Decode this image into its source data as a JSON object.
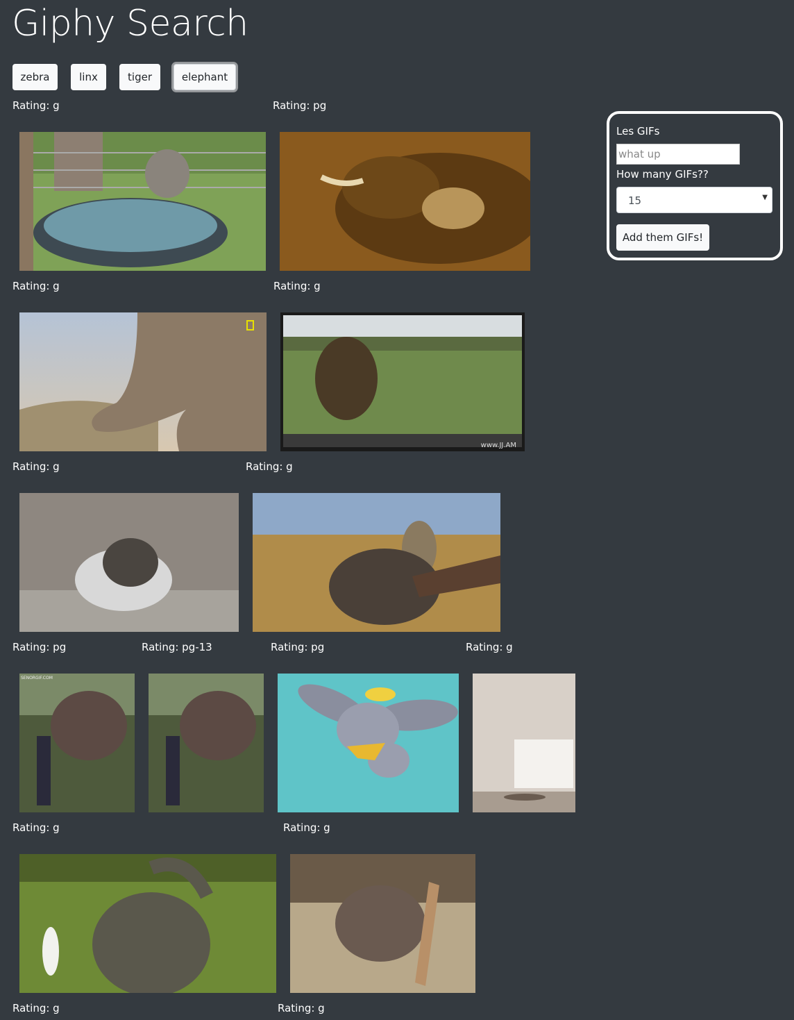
{
  "title": "Giphy Search",
  "topics": [
    "zebra",
    "linx",
    "tiger",
    "elephant"
  ],
  "active_topic": "elephant",
  "ratings": {
    "r1": [
      "Rating: g",
      "Rating: pg"
    ],
    "r2": [
      "Rating: g",
      "Rating: g"
    ],
    "r3": [
      "Rating: g",
      "Rating: g"
    ],
    "r4": [
      "Rating: pg",
      "Rating: pg-13",
      "Rating: pg",
      "Rating: g"
    ],
    "r5": [
      "Rating: g",
      "Rating: g"
    ],
    "r6": [
      "Rating: g",
      "Rating: g"
    ]
  },
  "gif_watermarks": {
    "bear": "www.JJ.AM",
    "elephant_small": "SENORGIF.COM"
  },
  "form": {
    "heading": "Les GIFs",
    "search_placeholder": "what up",
    "count_label": "How many GIFs??",
    "count_value": "15",
    "submit_label": "Add them GIFs!"
  }
}
